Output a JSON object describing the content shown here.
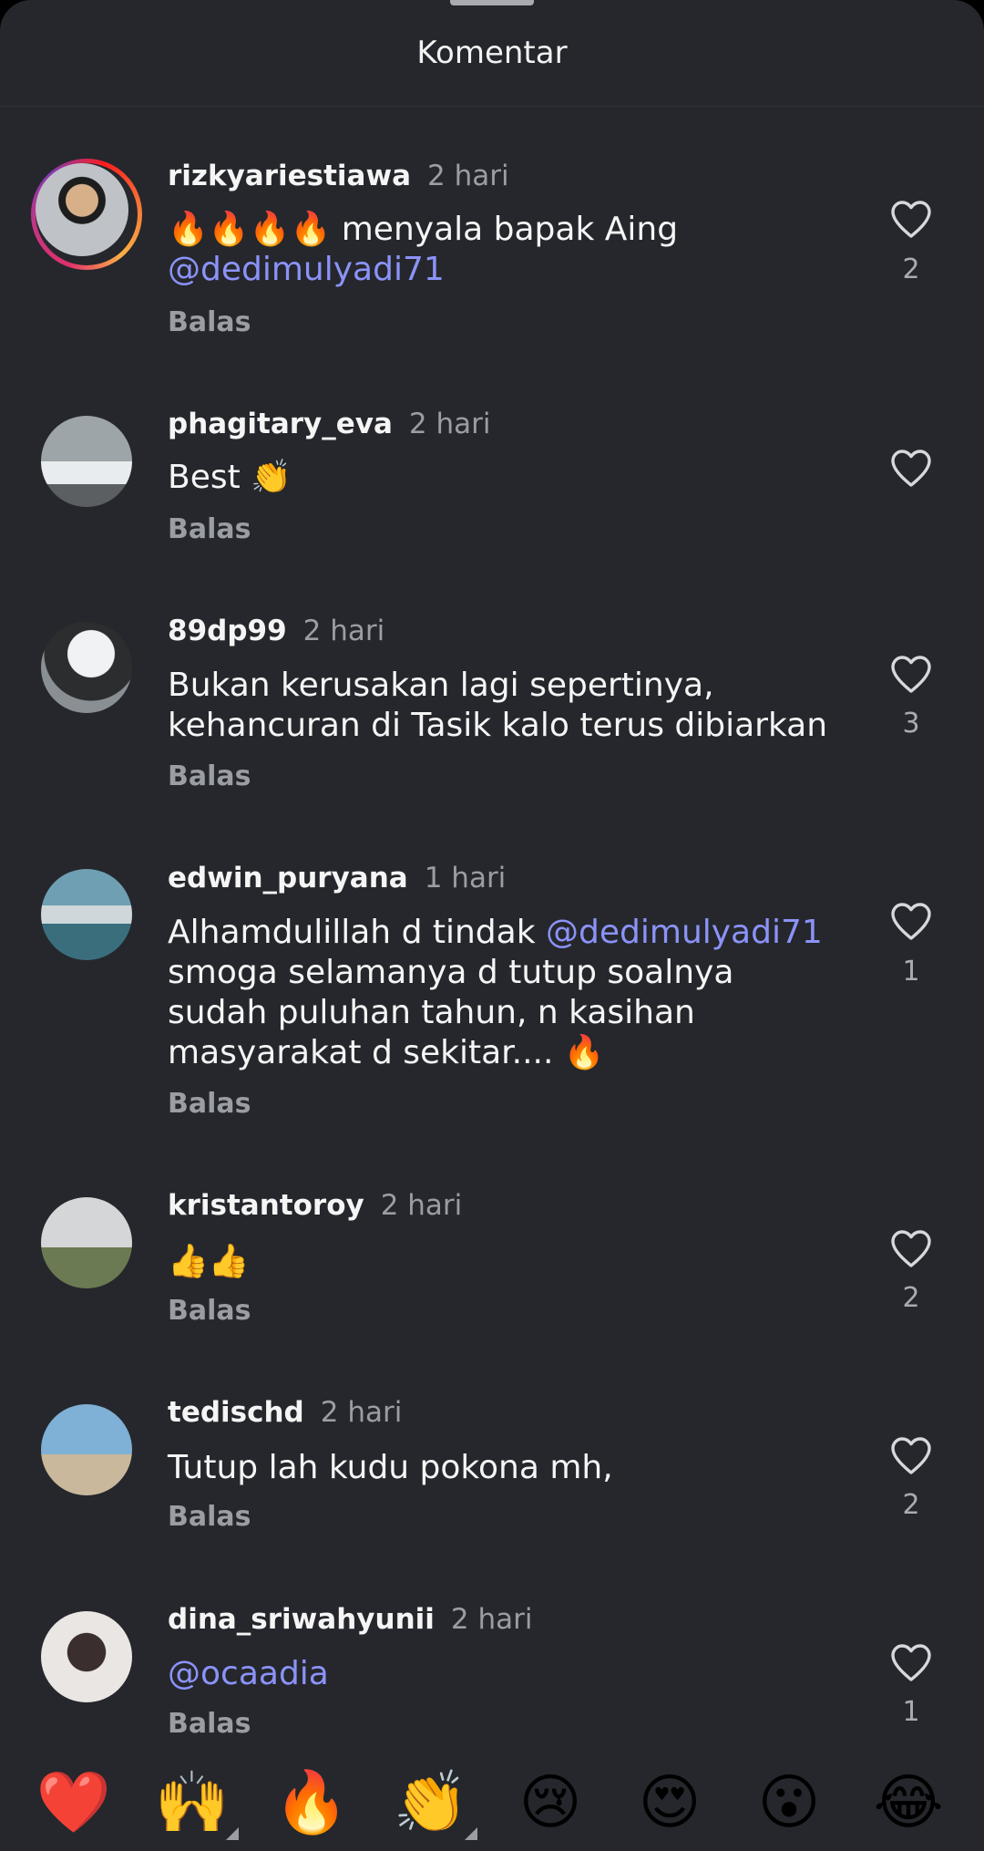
{
  "sheet": {
    "title": "Komentar"
  },
  "comments": [
    {
      "username": "rizkyariestiawa",
      "time": "2 hari",
      "text_before": "🔥🔥🔥🔥 menyala bapak Aing",
      "mention": "@dedimulyadi71",
      "text_after": "",
      "reply": "Balas",
      "likes": "2",
      "has_story": true
    },
    {
      "username": "phagitary_eva",
      "time": "2 hari",
      "text_before": "Best 👏",
      "mention": "",
      "text_after": "",
      "reply": "Balas",
      "likes": "",
      "has_story": false
    },
    {
      "username": "89dp99",
      "time": "2 hari",
      "text_before": "Bukan kerusakan lagi sepertinya, kehancuran di Tasik kalo terus dibiarkan",
      "mention": "",
      "text_after": "",
      "reply": "Balas",
      "likes": "3",
      "has_story": false
    },
    {
      "username": "edwin_puryana",
      "time": "1 hari",
      "text_before": "Alhamdulillah d tindak ",
      "mention": "@dedimulyadi71",
      "text_after": " smoga selamanya d tutup soalnya sudah puluhan tahun, n kasihan masyarakat d sekitar.... 🔥",
      "reply": "Balas",
      "likes": "1",
      "has_story": false
    },
    {
      "username": "kristantoroy",
      "time": "2 hari",
      "text_before": "👍👍",
      "mention": "",
      "text_after": "",
      "reply": "Balas",
      "likes": "2",
      "has_story": false
    },
    {
      "username": "tedischd",
      "time": "2 hari",
      "text_before": "Tutup lah kudu pokona mh,",
      "mention": "",
      "text_after": "",
      "reply": "Balas",
      "likes": "2",
      "has_story": false
    },
    {
      "username": "dina_sriwahyunii",
      "time": "2 hari",
      "text_before": "",
      "mention": "@ocaadia",
      "text_after": "",
      "reply": "Balas",
      "likes": "1",
      "has_story": false
    }
  ],
  "emoji_bar": {
    "emojis": [
      "❤️",
      "🙌",
      "🔥",
      "👏",
      "😢",
      "😍",
      "😮",
      "😂"
    ]
  },
  "icons": {
    "like": "heart-outline-icon"
  }
}
